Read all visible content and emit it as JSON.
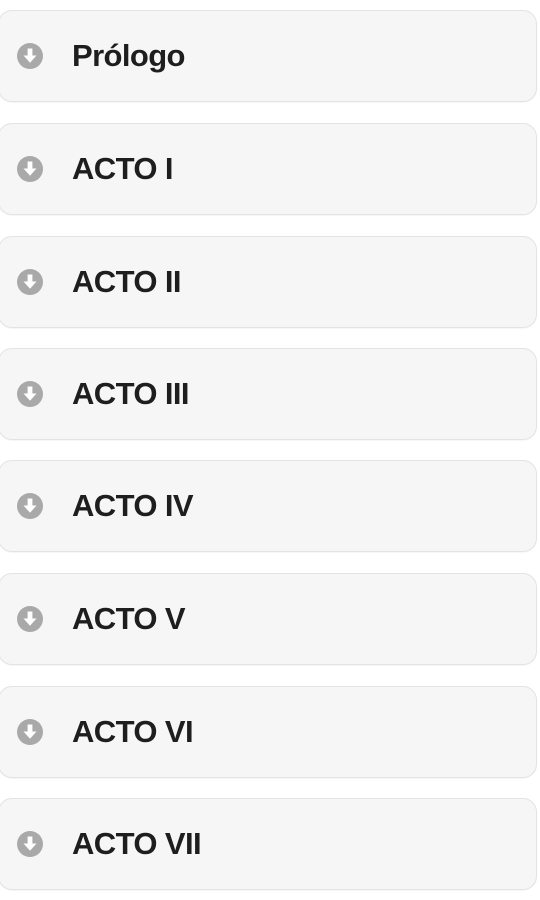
{
  "accordion": {
    "items": [
      {
        "label": "Prólogo",
        "icon": "arrow-down-circle-icon"
      },
      {
        "label": "ACTO I",
        "icon": "arrow-down-circle-icon"
      },
      {
        "label": "ACTO II",
        "icon": "arrow-down-circle-icon"
      },
      {
        "label": "ACTO III",
        "icon": "arrow-down-circle-icon"
      },
      {
        "label": "ACTO IV",
        "icon": "arrow-down-circle-icon"
      },
      {
        "label": "ACTO V",
        "icon": "arrow-down-circle-icon"
      },
      {
        "label": "ACTO VI",
        "icon": "arrow-down-circle-icon"
      },
      {
        "label": "ACTO VII",
        "icon": "arrow-down-circle-icon"
      }
    ],
    "icon_color": "#a9a9a9",
    "text_color": "#1e1e1e",
    "item_background": "#f6f6f6"
  }
}
